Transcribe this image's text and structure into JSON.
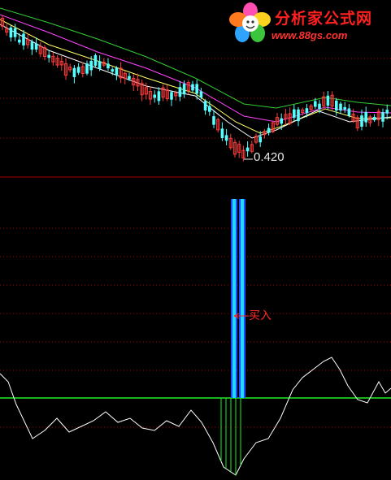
{
  "logo": {
    "title": "分析家公式网",
    "url": "www.88gs.com"
  },
  "price_panel": {
    "low_label": "0.420"
  },
  "indicator_panel": {
    "signal_label": "买入"
  },
  "colors": {
    "background": "#000000",
    "up_candle": "#ff3b3b",
    "down_candle": "#54ffff",
    "ma_white": "#ffffff",
    "ma_yellow": "#ffff66",
    "ma_magenta": "#ff44ff",
    "ma_green": "#33cc33",
    "panel_divider": "#aa0000",
    "grid_dotted": "#aa0000",
    "zero_line": "#22ee22",
    "signal_bar_outer": "#1a4dff",
    "signal_bar_inner": "#22d8ff",
    "indicator_line": "#ffffff",
    "histogram": "#22ee22"
  },
  "chart_data": {
    "type": "line",
    "panels": [
      {
        "name": "price",
        "series": [
          {
            "values": [
              10,
              22,
              35,
              45,
              55,
              62,
              70,
              74,
              76,
              82,
              90,
              98,
              100,
              104,
              108,
              116,
              124,
              132,
              140,
              148,
              150,
              148,
              146,
              140,
              138,
              136
            ]
          }
        ]
      },
      {
        "name": "oscillator",
        "series": [
          {
            "values": [
              0,
              -12,
              -24,
              -14,
              -2,
              -8,
              -4,
              -2,
              -14,
              -38,
              -40,
              -28,
              -6,
              12,
              26,
              24,
              10,
              4,
              0,
              6
            ]
          }
        ]
      }
    ]
  }
}
